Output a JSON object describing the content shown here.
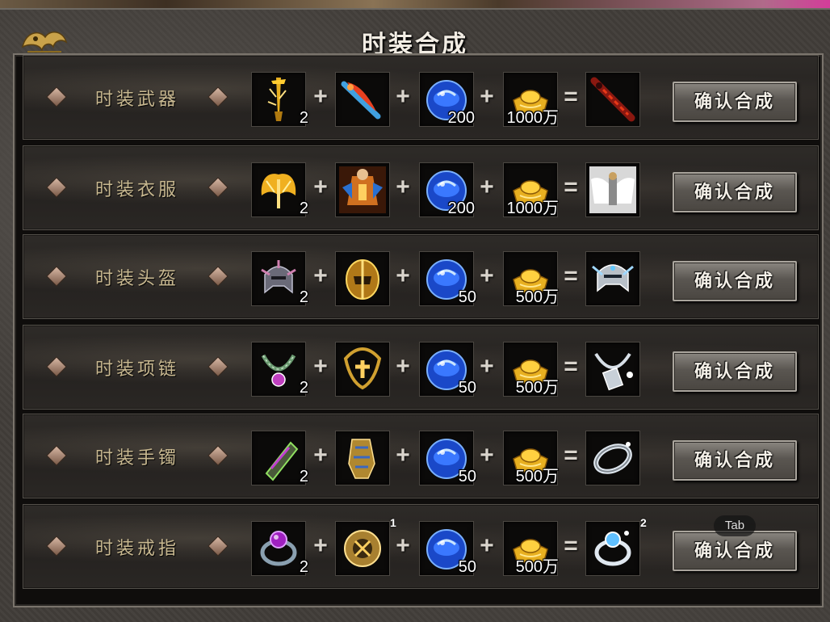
{
  "window": {
    "title": "时装合成",
    "logo_icon": "dragon-emblem-icon"
  },
  "plus_symbol": "+",
  "equals_symbol": "=",
  "rows": [
    {
      "label": "时装武器",
      "ingredient_1": {
        "icon": "golden-sword-icon",
        "qty": "2"
      },
      "ingredient_2": {
        "icon": "flame-blade-icon"
      },
      "ingredient_3": {
        "icon": "blue-gem-icon",
        "qty": "200"
      },
      "ingredient_4": {
        "icon": "gold-ingot-icon",
        "qty": "1000万"
      },
      "result": {
        "icon": "crimson-sword-icon"
      },
      "button": "确认合成"
    },
    {
      "label": "时装衣服",
      "ingredient_1": {
        "icon": "golden-wings-icon",
        "qty": "2"
      },
      "ingredient_2": {
        "icon": "warrior-armor-icon"
      },
      "ingredient_3": {
        "icon": "blue-gem-icon",
        "qty": "200"
      },
      "ingredient_4": {
        "icon": "gold-ingot-icon",
        "qty": "1000万"
      },
      "result": {
        "icon": "white-angel-armor-icon"
      },
      "button": "确认合成"
    },
    {
      "label": "时装头盔",
      "ingredient_1": {
        "icon": "spiked-helmet-icon",
        "qty": "2"
      },
      "ingredient_2": {
        "icon": "golden-helmet-icon"
      },
      "ingredient_3": {
        "icon": "blue-gem-icon",
        "qty": "50"
      },
      "ingredient_4": {
        "icon": "gold-ingot-icon",
        "qty": "500万"
      },
      "result": {
        "icon": "silver-helmet-icon"
      },
      "button": "确认合成"
    },
    {
      "label": "时装项链",
      "ingredient_1": {
        "icon": "jeweled-necklace-icon",
        "qty": "2"
      },
      "ingredient_2": {
        "icon": "gold-chain-icon"
      },
      "ingredient_3": {
        "icon": "blue-gem-icon",
        "qty": "50"
      },
      "ingredient_4": {
        "icon": "gold-ingot-icon",
        "qty": "500万"
      },
      "result": {
        "icon": "silver-necklace-icon"
      },
      "button": "确认合成"
    },
    {
      "label": "时装手镯",
      "ingredient_1": {
        "icon": "green-bracer-icon",
        "qty": "2"
      },
      "ingredient_2": {
        "icon": "gold-gauntlet-icon"
      },
      "ingredient_3": {
        "icon": "blue-gem-icon",
        "qty": "50"
      },
      "ingredient_4": {
        "icon": "gold-ingot-icon",
        "qty": "500万"
      },
      "result": {
        "icon": "silver-bracelet-icon"
      },
      "button": "确认合成"
    },
    {
      "label": "时装戒指",
      "ingredient_1": {
        "icon": "purple-ring-icon",
        "qty": "2"
      },
      "ingredient_2": {
        "icon": "gold-ring-icon",
        "badge": "1"
      },
      "ingredient_3": {
        "icon": "blue-gem-icon",
        "qty": "50"
      },
      "ingredient_4": {
        "icon": "gold-ingot-icon",
        "qty": "500万"
      },
      "result": {
        "icon": "silver-ring-icon",
        "badge": "2"
      },
      "button": "确认合成"
    }
  ],
  "tooltip": "Tab"
}
